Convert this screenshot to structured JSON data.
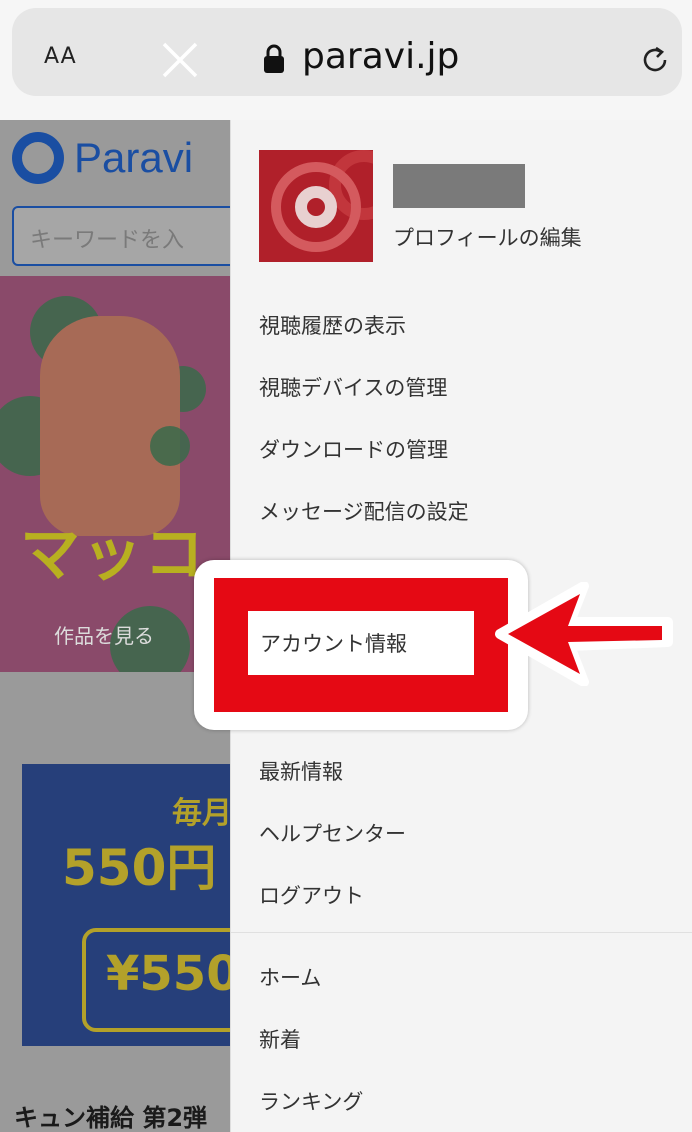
{
  "browser": {
    "aa_label": "AA",
    "url": "paravi.jp",
    "lock_icon": "lock-icon",
    "reload_icon": "reload-icon"
  },
  "site": {
    "logo_text": "Paravi",
    "search_placeholder": "キーワードを入",
    "banner_title": "マッコ",
    "banner_cta": "作品を見る",
    "promo_monthly": "毎月",
    "promo_price": "550円",
    "promo_ticket": "¥550",
    "caption": "キュン補給 第2弾"
  },
  "menu": {
    "edit_profile": "プロフィールの編集",
    "items": [
      {
        "label": "視聴履歴の表示"
      },
      {
        "label": "視聴デバイスの管理"
      },
      {
        "label": "ダウンロードの管理"
      },
      {
        "label": "メッセージ配信の設定"
      },
      {
        "label": "アカウント情報"
      },
      {
        "label": "最新情報"
      },
      {
        "label": "ヘルプセンター"
      },
      {
        "label": "ログアウト"
      },
      {
        "label": "ホーム"
      },
      {
        "label": "新着"
      },
      {
        "label": "ランキング"
      }
    ]
  },
  "annotation": {
    "highlight_color": "#e50914"
  }
}
